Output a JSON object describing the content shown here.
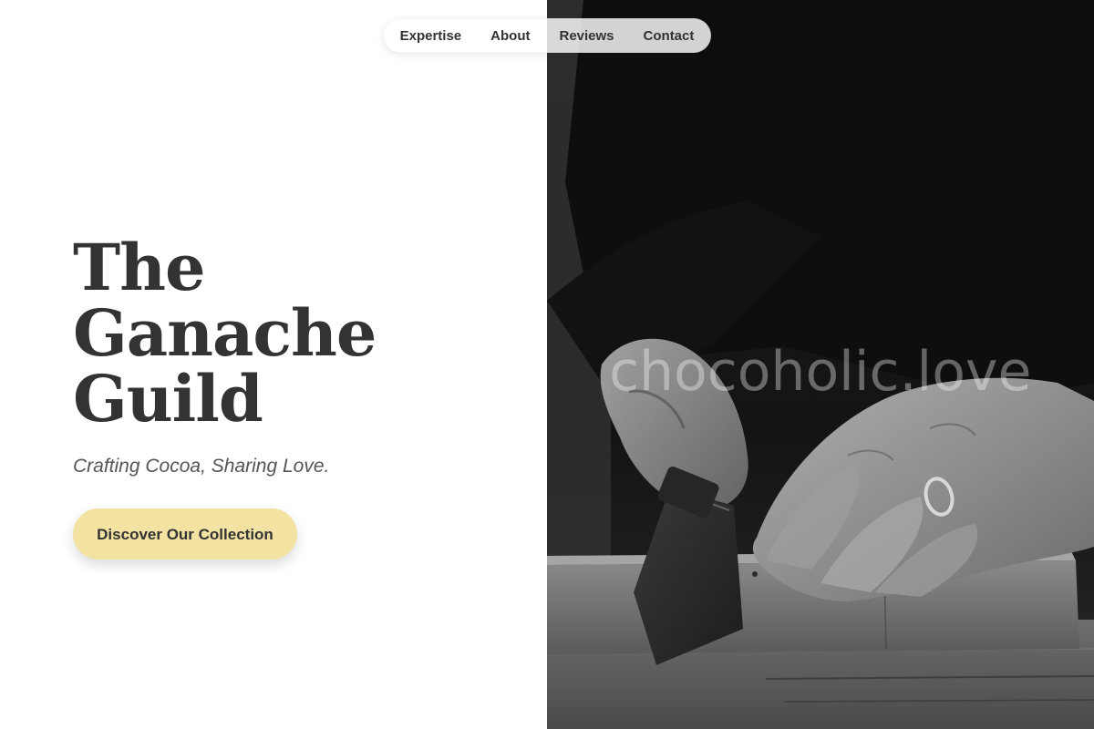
{
  "nav": {
    "items": [
      {
        "label": "Expertise"
      },
      {
        "label": "About"
      },
      {
        "label": "Reviews"
      },
      {
        "label": "Contact"
      }
    ]
  },
  "hero": {
    "title_line1": "The Ganache",
    "title_line2": "Guild",
    "tagline": "Crafting Cocoa, Sharing Love.",
    "cta_label": "Discover Our Collection"
  },
  "photo": {
    "watermark": "chocoholic.love"
  },
  "colors": {
    "cta_background": "#f2e3a3",
    "heading_text": "#333333",
    "tagline_text": "#555555",
    "photo_panel": "#111111"
  }
}
